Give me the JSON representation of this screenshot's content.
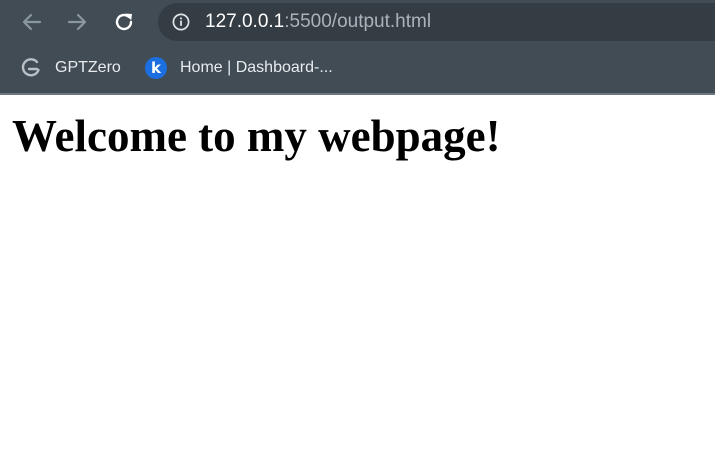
{
  "browser": {
    "nav": {
      "back_icon": "arrow-left-icon",
      "forward_icon": "arrow-right-icon",
      "reload_icon": "reload-icon"
    },
    "omnibox": {
      "icon": "info-icon",
      "url_host": "127.0.0.1",
      "url_rest": ":5500/output.html"
    },
    "bookmarks": [
      {
        "label": "GPTZero",
        "icon": "gptzero-logo-icon"
      },
      {
        "label": "Home | Dashboard-...",
        "icon": "k-logo-icon"
      }
    ],
    "colors": {
      "chrome_bg": "#414c54",
      "omnibox_bg": "#343d44",
      "k_icon_bg": "#1b6fe0"
    }
  },
  "page": {
    "heading": "Welcome to my webpage!"
  }
}
